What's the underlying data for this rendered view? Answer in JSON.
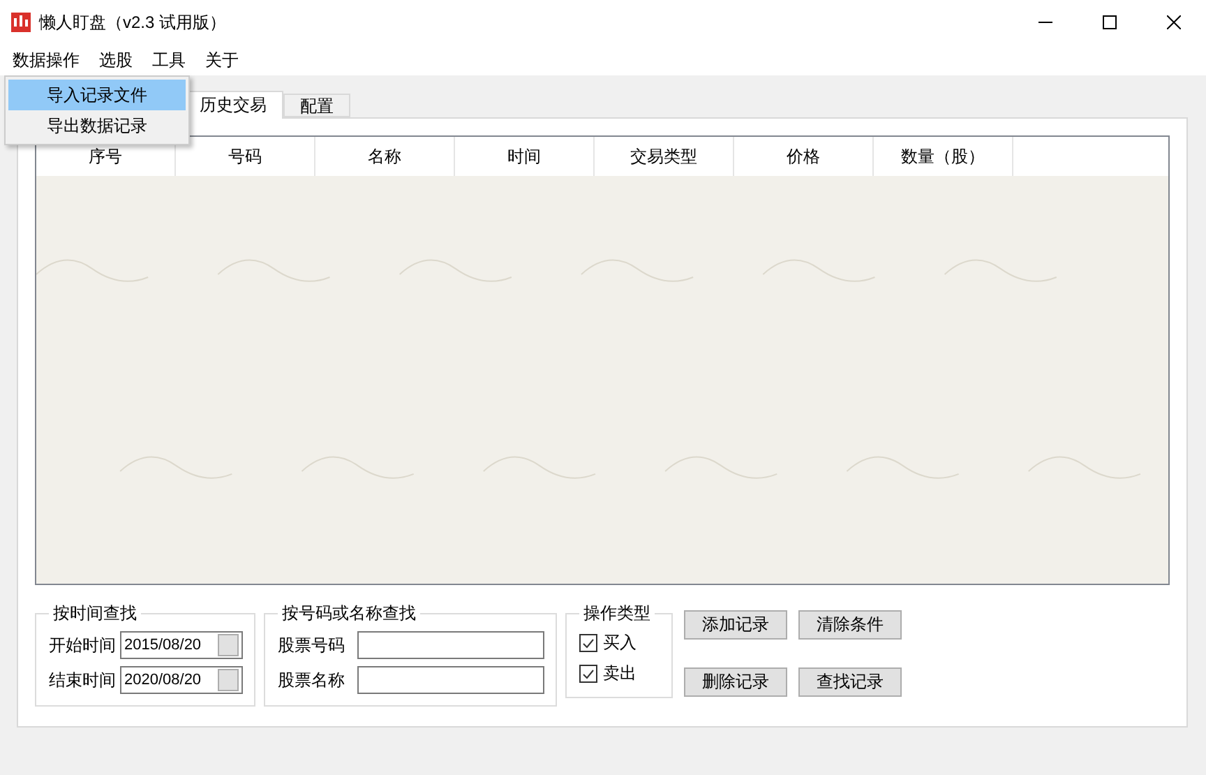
{
  "window": {
    "title": "懒人盯盘（v2.3 试用版）"
  },
  "menu_bar": [
    {
      "label": "数据操作"
    },
    {
      "label": "选股"
    },
    {
      "label": "工具"
    },
    {
      "label": "关于"
    }
  ],
  "open_menu": {
    "items": [
      {
        "label": "导入记录文件",
        "selected": true
      },
      {
        "label": "导出数据记录",
        "selected": false
      }
    ]
  },
  "tabs": [
    {
      "label": "历史交易",
      "selected": true
    },
    {
      "label": "配置",
      "selected": false
    }
  ],
  "table": {
    "columns": [
      "序号",
      "号码",
      "名称",
      "时间",
      "交易类型",
      "价格",
      "数量（股）"
    ]
  },
  "time_search": {
    "title": "按时间查找",
    "fields": [
      {
        "label": "开始时间",
        "value": "2015/08/20"
      },
      {
        "label": "结束时间",
        "value": "2020/08/20"
      }
    ]
  },
  "code_search": {
    "title": "按号码或名称查找",
    "fields": [
      {
        "label": "股票号码"
      },
      {
        "label": "股票名称"
      }
    ]
  },
  "trade_type": {
    "title": "操作类型",
    "options": [
      {
        "label": "买入",
        "checked": true
      },
      {
        "label": "卖出",
        "checked": true
      }
    ]
  },
  "buttons": [
    "添加记录",
    "清除条件",
    "删除记录",
    "查找记录"
  ]
}
